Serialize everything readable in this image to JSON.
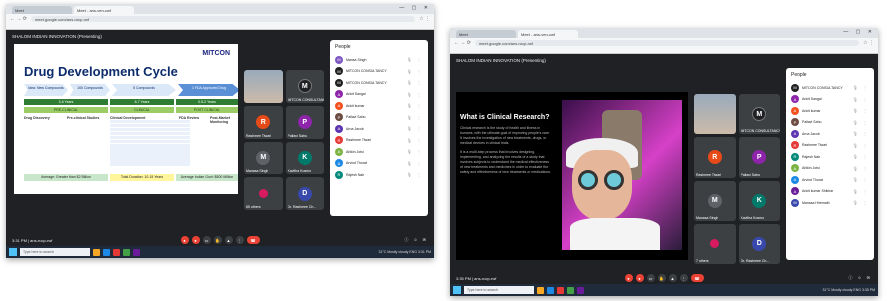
{
  "screenshot1": {
    "browser": {
      "tabs": [
        "Meet",
        "Meet - ans-ven-cwf"
      ],
      "url": "meet.google.com/ans-rucp-rwf"
    },
    "meet_title": "SHALOM INDIAN INNOVATION (Presenting)",
    "slide": {
      "brand": "MITCON",
      "title": "Drug Development Cycle",
      "stages": [
        "Idea: New Compounds",
        "100 Compounds",
        "5 Compounds",
        "1 FDA Approved Drug"
      ],
      "durations": [
        "3-6 Years",
        "6-7 Years",
        "0.5-2 Years"
      ],
      "phases": [
        "PRE-CLINICAL",
        "CLINICAL",
        "POST CLINICAL"
      ],
      "col_heads": [
        "Drug Discovery",
        "Pre-clinical Studies",
        "Clinical Development",
        "FDA Review",
        "Post-Market Monitoring"
      ],
      "footers": [
        "Average: Greater than $2 Billion",
        "Total Duration: 10-15 Years",
        "Average Indian Govt: $500 Million"
      ]
    },
    "tiles": [
      {
        "label": ""
      },
      {
        "label": "MITCON CONSULTANCY",
        "initial": "M"
      },
      {
        "label": "Rashmee Tiwari",
        "initial": "R"
      },
      {
        "label": "Pallavi Sahu",
        "initial": "P"
      },
      {
        "label": "Manasa Singh",
        "initial": "M"
      },
      {
        "label": "Kavitha Kosmo",
        "initial": "K"
      },
      {
        "label": "65 others",
        "initial": ""
      },
      {
        "label": "Dr. Rashmee Ch...",
        "initial": "D"
      }
    ],
    "people_panel": {
      "title": "People",
      "list": [
        {
          "name": "Mansa Singh",
          "initial": "M",
          "color": "#7e57c2"
        },
        {
          "name": "MITCON CONSULTANCY",
          "initial": "M",
          "color": "#212121"
        },
        {
          "name": "MITCON CONSULTANCY",
          "initial": "M",
          "color": "#212121"
        },
        {
          "name": "Ankit Sangai",
          "initial": "A",
          "color": "#8e24aa"
        },
        {
          "name": "Ankit kumar",
          "initial": "A",
          "color": "#f4511e"
        },
        {
          "name": "Pallavi Sahu",
          "initial": "P",
          "color": "#6d4c41"
        },
        {
          "name": "Arna Jacob",
          "initial": "A",
          "color": "#5e35b1"
        },
        {
          "name": "Rashmee Tiwari",
          "initial": "R",
          "color": "#e53935"
        },
        {
          "name": "Ahikin Jotsi",
          "initial": "A",
          "color": "#7cb342"
        },
        {
          "name": "Arvind Thorat",
          "initial": "A",
          "color": "#1e88e5"
        },
        {
          "name": "Rajesh Nair",
          "initial": "R",
          "color": "#00897b"
        }
      ]
    },
    "controls": {
      "time": "3:31 PM | ans-rucp-rwf"
    },
    "taskbar": {
      "search": "Type here to search",
      "tray": "31°C Mostly cloudy  ENG  3:31 PM"
    }
  },
  "screenshot2": {
    "browser": {
      "tabs": [
        "Meet",
        "Meet - ans-ven-cwf"
      ],
      "url": "meet.google.com/ans-rucp-rwf"
    },
    "meet_title": "SHALOM INDIAN INNOVATION (Presenting)",
    "slide": {
      "heading": "What is Clinical Research?",
      "para1": "Clinical research is the study of health and illness in humans, with the ultimate goal of improving people's care. It involves the investigation of new treatments, drugs, or medical devices in clinical trials.",
      "para2": "It is a multi-step process that involves designing, implementing, and analyzing the results of a study that involves subjects to understand the medical effectiveness of new treatments and medicines in order to evaluate the safety and effectiveness of new treatments or medications."
    },
    "tiles": [
      {
        "label": ""
      },
      {
        "label": "MITCON CONSULTANCY",
        "initial": "M"
      },
      {
        "label": "Rashmee Tiwari",
        "initial": "R"
      },
      {
        "label": "Pallavi Sahu",
        "initial": "P"
      },
      {
        "label": "Manasa Singh",
        "initial": "M"
      },
      {
        "label": "Kavitha Kosmo",
        "initial": "K"
      },
      {
        "label": "7 others",
        "initial": ""
      },
      {
        "label": "Dr. Rashmee Ch...",
        "initial": "D"
      }
    ],
    "people_panel": {
      "title": "People",
      "list": [
        {
          "name": "MITCON CONSULTANCY",
          "initial": "M",
          "color": "#212121"
        },
        {
          "name": "Ankit Sangai",
          "initial": "A",
          "color": "#8e24aa"
        },
        {
          "name": "Ankit kumar",
          "initial": "A",
          "color": "#f4511e"
        },
        {
          "name": "Pallavi Sahu",
          "initial": "P",
          "color": "#6d4c41"
        },
        {
          "name": "Arna Jacob",
          "initial": "A",
          "color": "#5e35b1"
        },
        {
          "name": "Rashmee Tiwari",
          "initial": "R",
          "color": "#e53935"
        },
        {
          "name": "Rajesh Nair",
          "initial": "R",
          "color": "#00897b"
        },
        {
          "name": "Ahikin Jotsi",
          "initial": "A",
          "color": "#7cb342"
        },
        {
          "name": "Arvind Thorat",
          "initial": "A",
          "color": "#1e88e5"
        },
        {
          "name": "Ankit kumar Shikhar",
          "initial": "A",
          "color": "#6a1b9a"
        },
        {
          "name": "Manasa Hiremath",
          "initial": "M",
          "color": "#3949ab"
        }
      ]
    },
    "controls": {
      "time": "3:35 PM | ans-rucp-rwf"
    },
    "taskbar": {
      "search": "Type here to search",
      "tray": "31°C Mostly cloudy  ENG  3:35 PM"
    }
  }
}
